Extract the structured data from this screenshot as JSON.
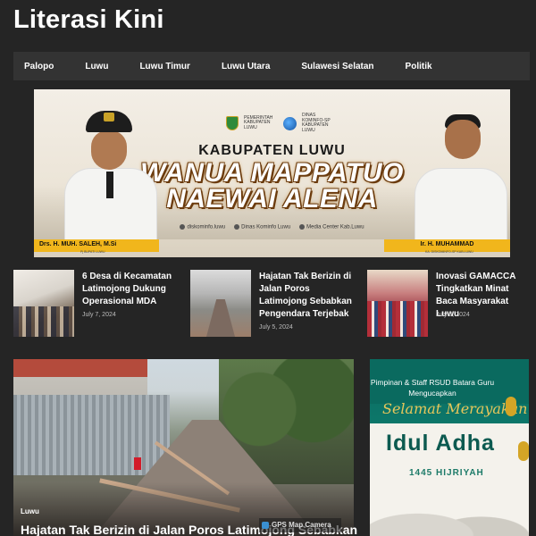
{
  "site": {
    "title": "Literasi Kini"
  },
  "nav": {
    "items": [
      {
        "label": "Palopo"
      },
      {
        "label": "Luwu"
      },
      {
        "label": "Luwu Timur"
      },
      {
        "label": "Luwu Utara"
      },
      {
        "label": "Sulawesi Selatan"
      },
      {
        "label": "Politik"
      }
    ]
  },
  "banner": {
    "logo_text_1": "PEMERINTAH KABUPATEN LUWU",
    "logo_text_2": "DINAS KOMINFO-SP KABUPATEN LUWU",
    "region": "KABUPATEN LUWU",
    "slogan_line1": "WANUA MAPPATUO",
    "slogan_line2": "NAEWAI ALENA",
    "social_1": "diskominfo.luwu",
    "social_2": "Dinas Kominfo Luwu",
    "social_3": "Media Center Kab.Luwu",
    "person_left_name": "Drs. H. MUH. SALEH, M.Si",
    "person_left_title": "Pj BUPATI LUWU",
    "person_right_name": "Ir. H. MUHAMMAD",
    "person_right_title": "KA. DISKOMINFO-SP KAB.LUWU"
  },
  "posts": [
    {
      "title": "6 Desa di Kecamatan Latimojong Dukung Operasional MDA",
      "date": "July 7, 2024"
    },
    {
      "title": "Hajatan Tak Berizin di Jalan Poros Latimojong Sebabkan Pengendara Terjebak",
      "date": "July 5, 2024"
    },
    {
      "title": "Inovasi GAMACCA Tingkatkan Minat Baca Masyarakat Luwu",
      "date": "July 5, 2024"
    }
  ],
  "featured": {
    "category": "Luwu",
    "title": "Hajatan Tak Berizin di Jalan Poros Latimojong Sebabkan",
    "watermark": "GPS Map Camera"
  },
  "ad": {
    "line1": "Pimpinan & Staff RSUD Batara Guru Mengucapkan",
    "greeting": "Selamat Merayakan",
    "headline": "Idul Adha",
    "year": "1445 HIJRIYAH"
  }
}
